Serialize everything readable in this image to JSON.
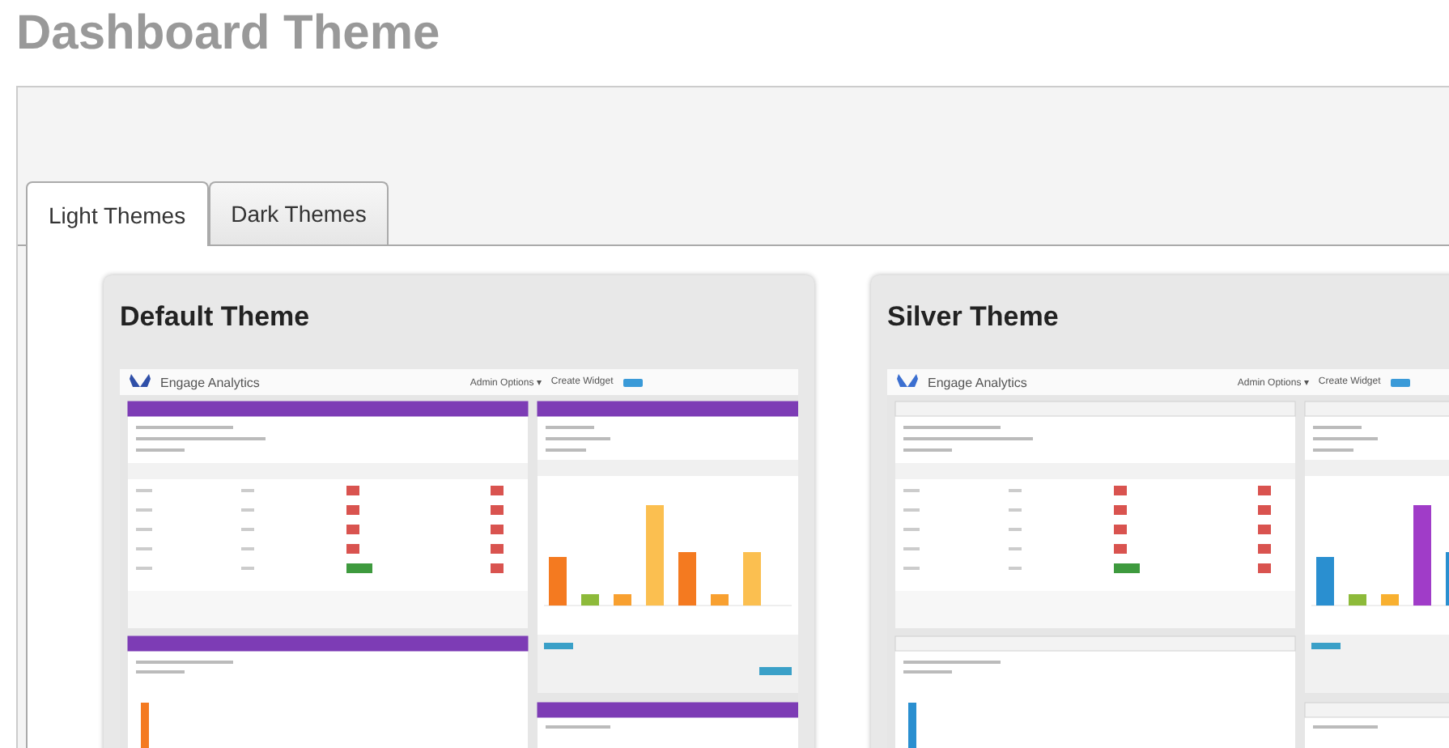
{
  "page_title": "Dashboard Theme",
  "tabs": [
    {
      "label": "Light Themes",
      "selected": true
    },
    {
      "label": "Dark Themes",
      "selected": false
    }
  ],
  "themes": [
    {
      "name": "Default Theme",
      "kind": "purple",
      "preview": {
        "app_name": "Engage Analytics",
        "admin_menu": "Admin Options ▾",
        "create_widget": "Create Widget"
      }
    },
    {
      "name": "Silver Theme",
      "kind": "silver",
      "preview": {
        "app_name": "Engage Analytics",
        "admin_menu": "Admin Options ▾",
        "create_widget": "Create Widget"
      }
    }
  ]
}
